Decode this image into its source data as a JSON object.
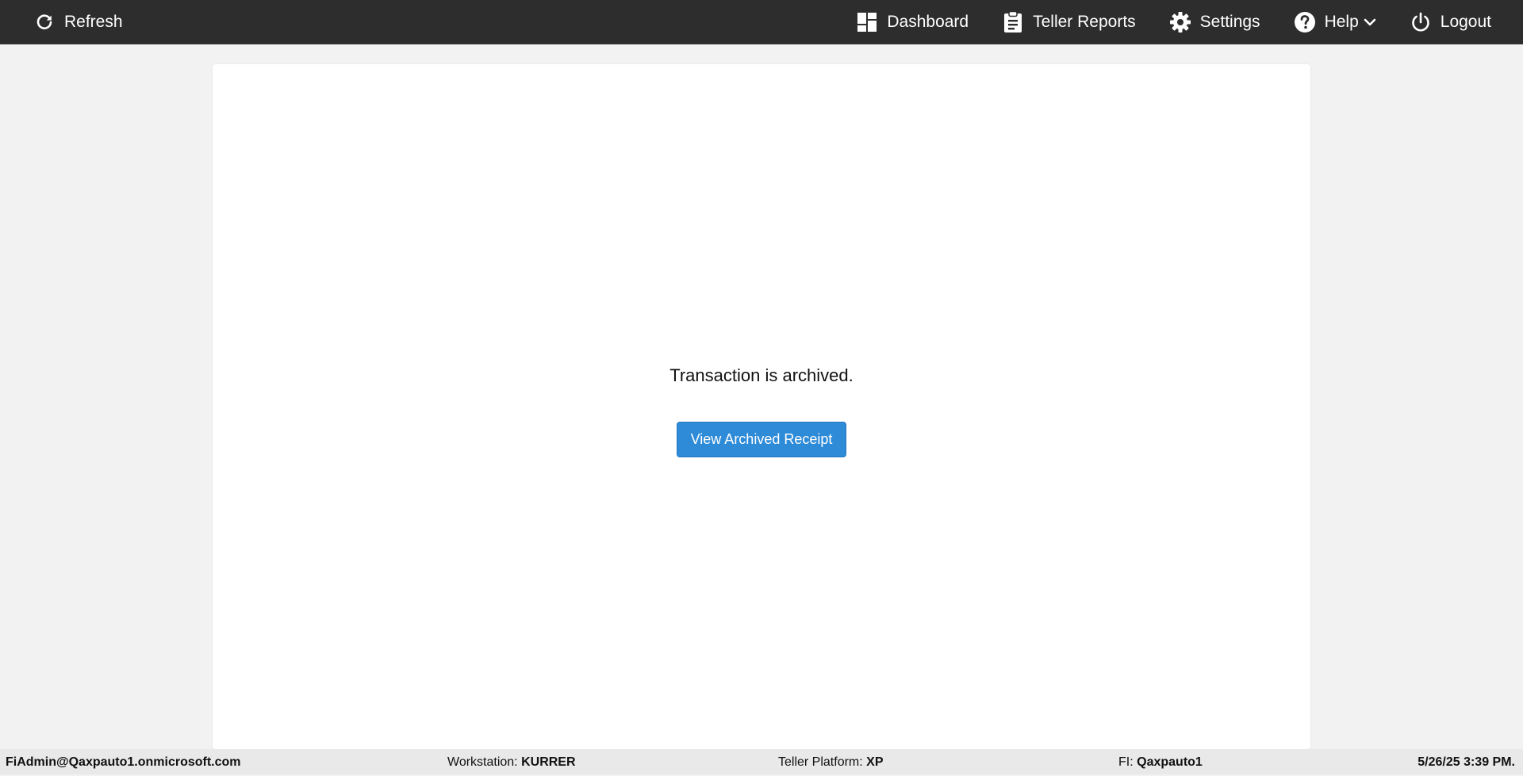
{
  "topbar": {
    "refresh_label": "Refresh",
    "nav": {
      "dashboard": "Dashboard",
      "teller_reports": "Teller Reports",
      "settings": "Settings",
      "help": "Help",
      "logout": "Logout"
    },
    "icons": {
      "refresh": "refresh-icon",
      "dashboard": "dashboard-icon",
      "teller_reports": "clipboard-icon",
      "settings": "gear-icon",
      "help": "question-circle-icon",
      "help_dropdown": "chevron-down-icon",
      "logout": "power-icon"
    },
    "bg_color": "#2d2d2d"
  },
  "main": {
    "message": "Transaction is archived.",
    "button_label": "View Archived Receipt",
    "button_color": "#2e8bd8"
  },
  "status": {
    "user": "FiAdmin@Qaxpauto1.onmicrosoft.com",
    "workstation_label": "Workstation:",
    "workstation": "KURRER",
    "platform_label": "Teller Platform:",
    "platform": "XP",
    "fi_label": "FI:",
    "fi": "Qaxpauto1",
    "datetime": "5/26/25 3:39 PM."
  }
}
